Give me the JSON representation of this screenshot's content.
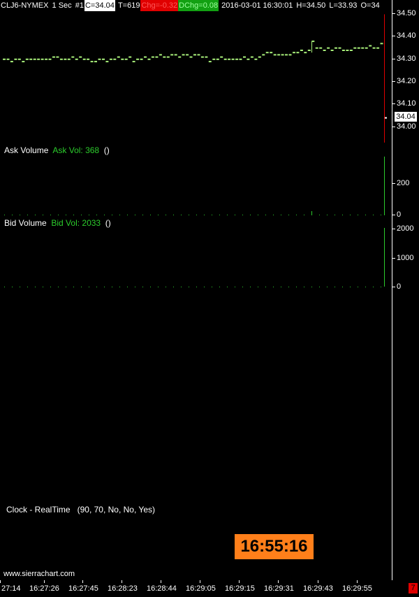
{
  "header": {
    "symbol": "CLJ6-NYMEX",
    "interval": "1 Sec",
    "chart_num": "#1",
    "close": "C=34.04",
    "trades": "T=619",
    "change": "Chg=-0.32",
    "daily_change": "DChg=0.08",
    "datetime": "2016-03-01 16:30:01",
    "high": "H=34.50",
    "low": "L=33.93",
    "open": "O=34"
  },
  "price_axis": {
    "ticks": [
      "34.50",
      "34.40",
      "34.30",
      "34.20",
      "34.10",
      "34.00"
    ],
    "current": "34.04"
  },
  "ask_volume": {
    "title": "Ask Volume",
    "value_label": "Ask Vol: 368",
    "extra": "()",
    "ticks": [
      "200",
      "0"
    ]
  },
  "bid_volume": {
    "title": "Bid Volume",
    "value_label": "Bid Vol: 2033",
    "extra": "()",
    "ticks": [
      "2000",
      "1000",
      "0"
    ]
  },
  "clock": {
    "title": "Clock - RealTime",
    "params": "(90, 70, No, No, Yes)",
    "time": "16:55:16"
  },
  "watermark": "www.sierrachart.com",
  "time_axis": [
    "27:14",
    "16:27:26",
    "16:27:45",
    "16:28:23",
    "16:28:44",
    "16:29:05",
    "16:29:15",
    "16:29:31",
    "16:29:43",
    "16:29:55"
  ],
  "corner_badge": "7",
  "colors": {
    "price_bars": "#a8f07a",
    "volume_bars": "#2ccc2c",
    "clock_bg": "#ff7f1a",
    "alert_red": "#e00000"
  },
  "chart_data": {
    "type": "line",
    "series": [
      {
        "values": [
          34.3,
          34.3,
          34.29,
          34.3,
          34.3,
          34.29,
          34.3,
          34.3,
          34.3,
          34.3,
          34.3,
          34.3,
          34.3,
          34.31,
          34.31,
          34.3,
          34.3,
          34.3,
          34.31,
          34.3,
          34.31,
          34.3,
          34.3,
          34.29,
          34.29,
          34.3,
          34.3,
          34.29,
          34.3,
          34.3,
          34.31,
          34.3,
          34.3,
          34.31,
          34.29,
          34.3,
          34.3,
          34.31,
          34.3,
          34.31,
          34.31,
          34.32,
          34.31,
          34.31,
          34.32,
          34.32,
          34.31,
          34.32,
          34.32,
          34.31,
          34.32,
          34.32,
          34.31,
          34.31,
          34.29,
          34.3,
          34.3,
          34.31,
          34.3,
          34.3,
          34.3,
          34.3,
          34.3,
          34.31,
          34.3,
          34.31,
          34.3,
          34.31,
          34.32,
          34.33,
          34.33,
          34.32,
          34.32,
          34.32,
          34.32,
          34.32,
          34.33,
          34.33,
          34.34,
          34.33,
          34.34,
          34.38,
          34.35,
          34.35,
          34.34,
          34.35,
          34.34,
          34.35,
          34.35,
          34.34,
          34.34,
          34.34,
          34.35,
          34.35,
          34.35,
          34.35,
          34.36,
          34.35,
          34.35,
          34.37,
          34.04
        ]
      }
    ],
    "ylim": [
      33.93,
      34.52
    ],
    "volume_ask_last": 368,
    "volume_bid_last": 2033
  }
}
